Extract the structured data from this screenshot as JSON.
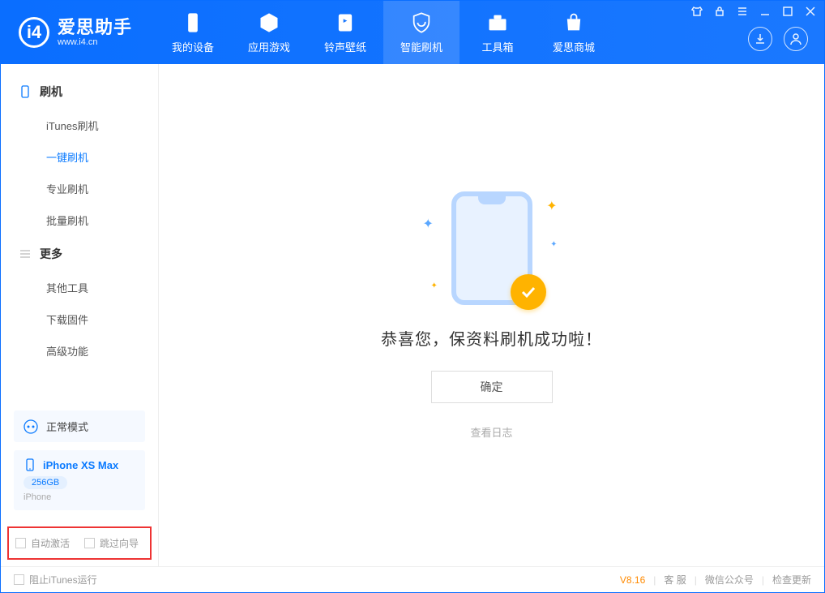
{
  "app": {
    "name": "爱思助手",
    "url": "www.i4.cn"
  },
  "tabs": {
    "device": "我的设备",
    "apps": "应用游戏",
    "ringtone": "铃声壁纸",
    "flash": "智能刷机",
    "toolbox": "工具箱",
    "store": "爱思商城"
  },
  "sidebar": {
    "group_flash": "刷机",
    "items_flash": {
      "itunes": "iTunes刷机",
      "oneclick": "一键刷机",
      "pro": "专业刷机",
      "batch": "批量刷机"
    },
    "group_more": "更多",
    "items_more": {
      "other": "其他工具",
      "firmware": "下载固件",
      "advanced": "高级功能"
    },
    "mode": "正常模式",
    "device_name": "iPhone XS Max",
    "device_storage": "256GB",
    "device_type": "iPhone",
    "opt_auto_activate": "自动激活",
    "opt_skip_guide": "跳过向导"
  },
  "main": {
    "success_msg": "恭喜您，保资料刷机成功啦！",
    "confirm_btn": "确定",
    "view_log": "查看日志"
  },
  "status": {
    "block_itunes": "阻止iTunes运行",
    "version": "V8.16",
    "support": "客 服",
    "wechat": "微信公众号",
    "update": "检查更新"
  }
}
